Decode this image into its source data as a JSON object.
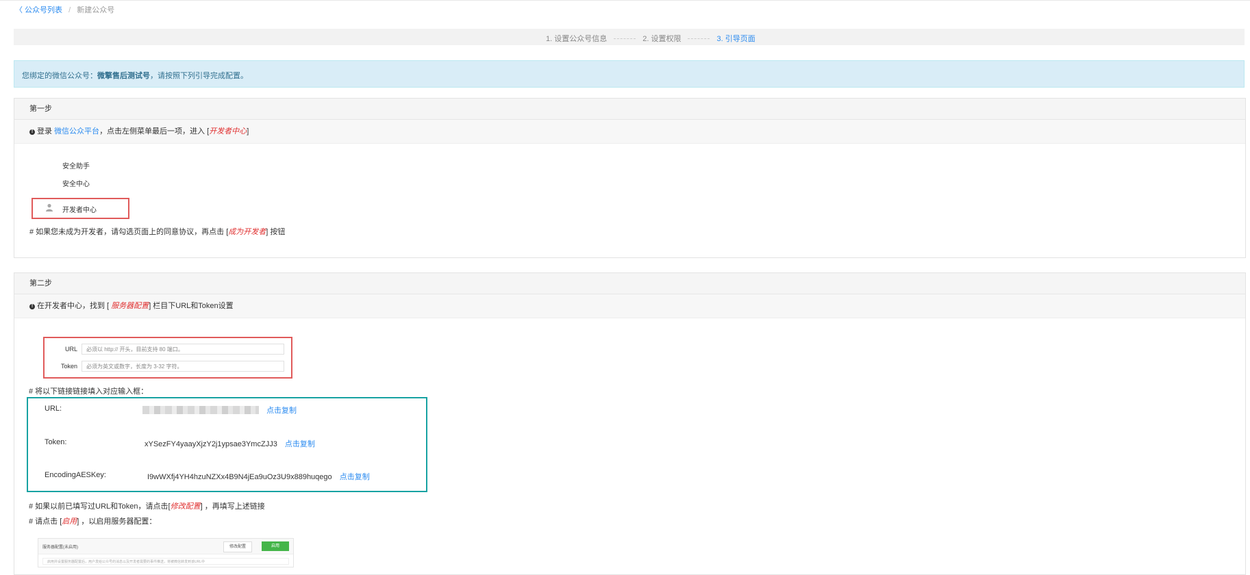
{
  "breadcrumb": {
    "back": "〈 公众号列表",
    "separator": "/",
    "current": "新建公众号"
  },
  "steps": {
    "s1": "1. 设置公众号信息",
    "s2": "2. 设置权限",
    "s3": "3. 引导页面"
  },
  "alert": {
    "prefix": "您绑定的微信公众号：",
    "account": "微擎售后测试号",
    "suffix": "，请按照下列引导完成配置。"
  },
  "step1": {
    "title": "第一步",
    "instr_a": "登录",
    "instr_link": "微信公众平台",
    "instr_b": "，点击左侧菜单最后一项，进入 [",
    "instr_red": "开发者中心",
    "instr_c": "]",
    "menu": [
      "安全助手",
      "安全中心",
      "开发者中心"
    ],
    "note_a": "# 如果您未成为开发者，请勾选页面上的同意协议，再点击 [",
    "note_red": "成为开发者",
    "note_b": "] 按钮"
  },
  "step2": {
    "title": "第二步",
    "instr_a": "在开发者中心，找到 [",
    "instr_red": "服务器配置",
    "instr_b": "] 栏目下URL和Token设置",
    "form": {
      "url_label": "URL",
      "url_placeholder": "必须以 http:// 开头，目前支持 80 端口。",
      "token_label": "Token",
      "token_placeholder": "必须为英文或数字，长度为 3-32 字符。"
    },
    "fill_note": "# 将以下链接链接填入对应输入框：",
    "values": {
      "url_label": "URL:",
      "token_label": "Token:",
      "token_value": "xYSezFY4yaayXjzY2j1ypsae3YmcZJJ3",
      "aes_label": "EncodingAESKey:",
      "aes_value": "I9wWXfj4YH4hzuNZXx4B9N4jEa9uOz3U9x889huqego",
      "copy_label": "点击复制"
    },
    "note1_a": "# 如果以前已填写过URL和Token，请点击[",
    "note1_red": "修改配置",
    "note1_b": "] ，再填写上述链接",
    "note2_a": "# 请点击 [",
    "note2_red": "启用",
    "note2_b": "] ，以启用服务器配置：",
    "mini": {
      "title": "服务器配置(未启用)",
      "modify": "修改配置",
      "enable": "启用",
      "desc": "启用并设置服务器配置后，用户发给公众号的消息以及开发者需要的事件推送，将被微信转发到该URL中"
    }
  }
}
